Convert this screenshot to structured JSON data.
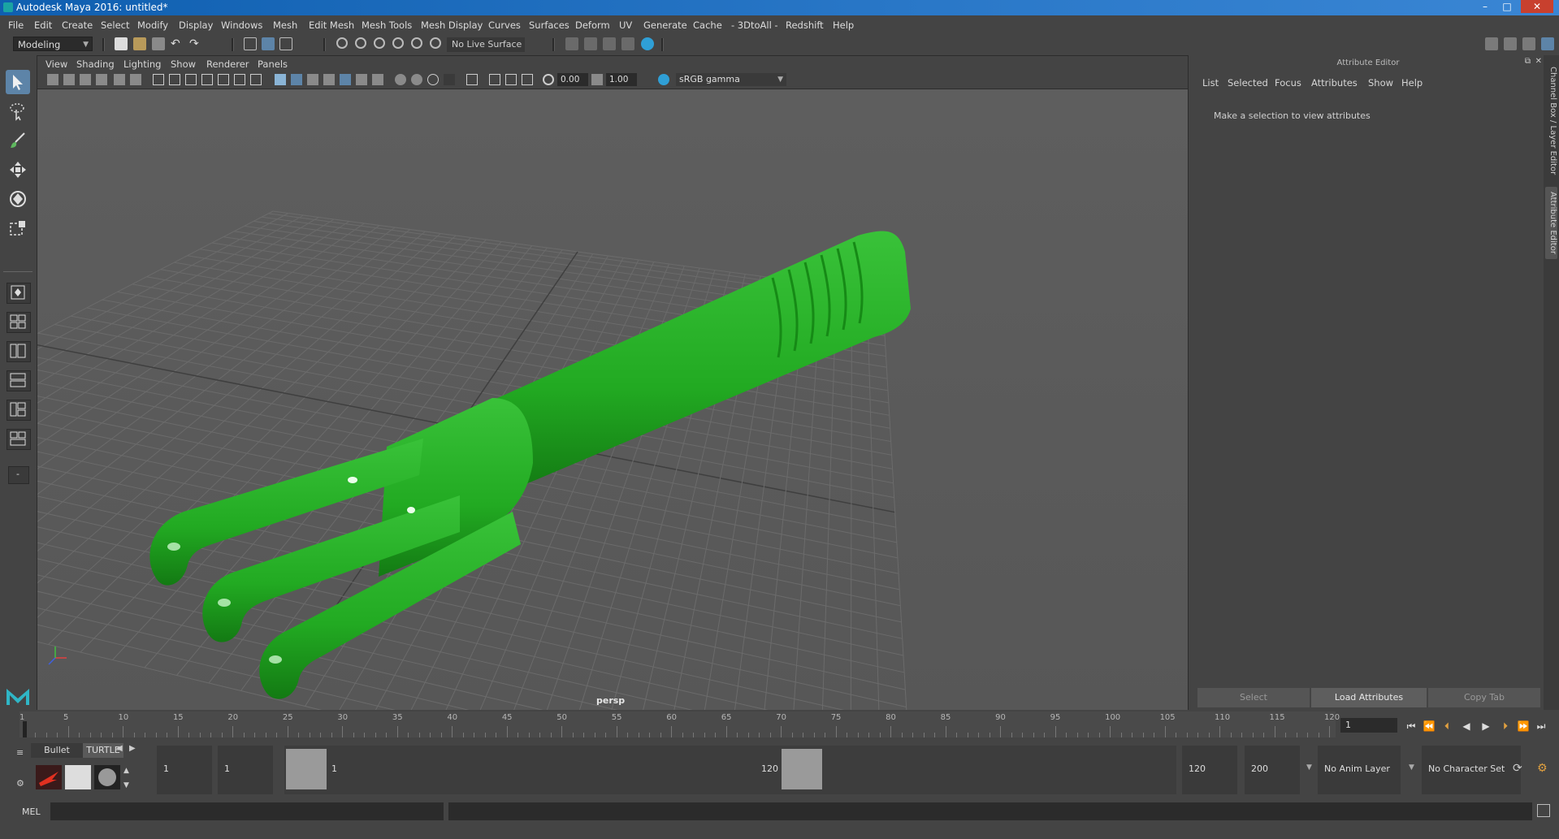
{
  "window": {
    "title": "Autodesk Maya 2016: untitled*",
    "minimize": "–",
    "maximize": "□",
    "close": "✕"
  },
  "menubar": [
    "File",
    "Edit",
    "Create",
    "Select",
    "Modify",
    "Display",
    "Windows",
    "Mesh",
    "Edit Mesh",
    "Mesh Tools",
    "Mesh Display",
    "Curves",
    "Surfaces",
    "Deform",
    "UV",
    "Generate",
    "Cache",
    "- 3DtoAll -",
    "Redshift",
    "Help"
  ],
  "statusline": {
    "menuset": "Modeling",
    "live_surface": "No Live Surface"
  },
  "viewport": {
    "menu": [
      "View",
      "Shading",
      "Lighting",
      "Show",
      "Renderer",
      "Panels"
    ],
    "near_value": "0.00",
    "far_value": "1.00",
    "color_management": "sRGB gamma",
    "camera": "persp",
    "object_color": "#22aa22"
  },
  "attribute_editor": {
    "title": "Attribute Editor",
    "menu": [
      "List",
      "Selected",
      "Focus",
      "Attributes",
      "Show",
      "Help"
    ],
    "message": "Make a selection to view attributes",
    "buttons": [
      "Select",
      "Load Attributes",
      "Copy Tab"
    ]
  },
  "side_tabs": [
    "Channel Box / Layer Editor",
    "Attribute Editor"
  ],
  "timeslider": {
    "labels": [
      "1",
      "5",
      "10",
      "15",
      "20",
      "25",
      "30",
      "35",
      "40",
      "45",
      "50",
      "55",
      "60",
      "65",
      "70",
      "75",
      "80",
      "85",
      "90",
      "95",
      "100",
      "105",
      "110",
      "115",
      "120"
    ],
    "current_frame": "1"
  },
  "shelf": {
    "tabs": [
      "Bullet",
      "TURTLE"
    ]
  },
  "range": {
    "start_time": "1",
    "playback_start": "1",
    "range_start_label": "1",
    "range_end_label": "120",
    "playback_end": "120",
    "end_time": "200",
    "anim_layer": "No Anim Layer",
    "character_set": "No Character Set"
  },
  "cmdline": {
    "label": "MEL"
  }
}
